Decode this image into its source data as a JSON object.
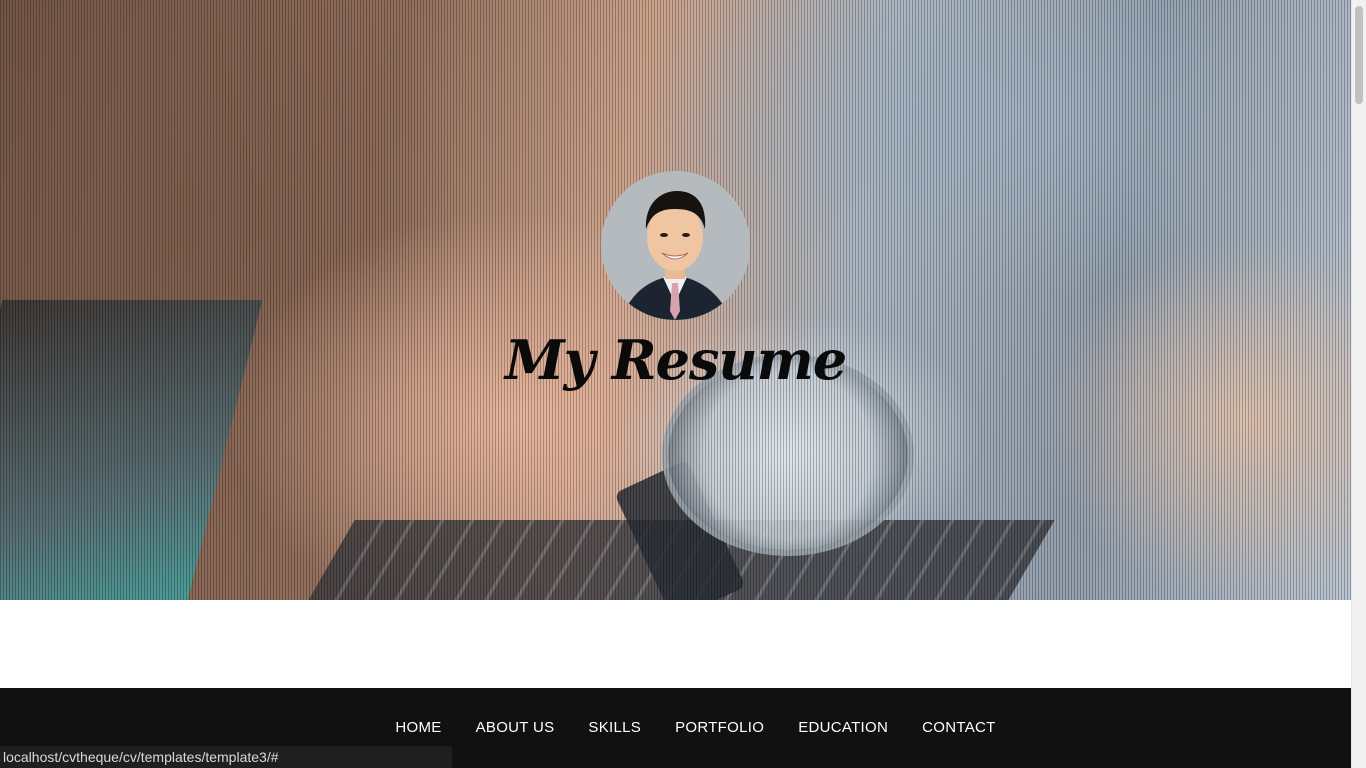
{
  "hero": {
    "title": "My Resume"
  },
  "nav": {
    "items": [
      {
        "label": "HOME"
      },
      {
        "label": "ABOUT US"
      },
      {
        "label": "SKILLS"
      },
      {
        "label": "PORTFOLIO"
      },
      {
        "label": "EDUCATION"
      },
      {
        "label": "CONTACT"
      }
    ]
  },
  "status_bar": {
    "url": "localhost/cvtheque/cv/templates/template3/#"
  },
  "colors": {
    "nav_background": "#111111",
    "nav_text": "#ffffff",
    "title_text": "#0a0a0a"
  }
}
